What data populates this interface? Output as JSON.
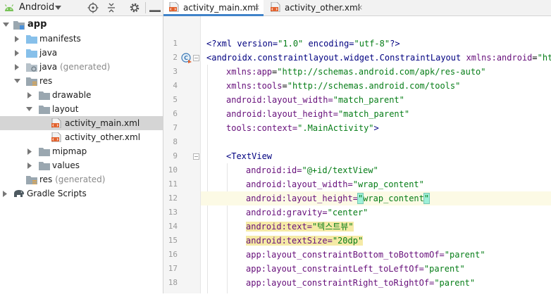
{
  "project_panel": {
    "view_title": "Android",
    "tree": [
      {
        "label": "app",
        "suffix": ""
      },
      {
        "label": "manifests",
        "suffix": ""
      },
      {
        "label": "java",
        "suffix": ""
      },
      {
        "label": "java",
        "suffix": " (generated)"
      },
      {
        "label": "res",
        "suffix": ""
      },
      {
        "label": "drawable",
        "suffix": ""
      },
      {
        "label": "layout",
        "suffix": ""
      },
      {
        "label": "activity_main.xml",
        "suffix": ""
      },
      {
        "label": "activity_other.xml",
        "suffix": ""
      },
      {
        "label": "mipmap",
        "suffix": ""
      },
      {
        "label": "values",
        "suffix": ""
      },
      {
        "label": "res",
        "suffix": " (generated)"
      },
      {
        "label": "Gradle Scripts",
        "suffix": ""
      }
    ]
  },
  "editor": {
    "tabs": [
      {
        "label": "activity_main.xml",
        "close": "×"
      },
      {
        "label": "activity_other.xml",
        "close": "×"
      }
    ],
    "line_numbers": [
      "1",
      "2",
      "3",
      "4",
      "5",
      "6",
      "7",
      "8",
      "9",
      "10",
      "11",
      "12",
      "13",
      "14",
      "15",
      "16",
      "17",
      "18"
    ],
    "code": {
      "l1": {
        "a": "<?xml version=",
        "b": "\"1.0\"",
        "c": " encoding=",
        "d": "\"utf-8\"",
        "e": "?>"
      },
      "l2": {
        "a": "<androidx.constraintlayout.widget.ConstraintLayout ",
        "b": "xmlns:",
        "c": "android",
        "d": "=",
        "e": "\"http"
      },
      "l3": {
        "a": "xmlns:",
        "b": "app",
        "c": "=",
        "d": "\"http://schemas.android.com/apk/res-auto\""
      },
      "l4": {
        "a": "xmlns:",
        "b": "tools",
        "c": "=",
        "d": "\"http://schemas.android.com/tools\""
      },
      "l5": {
        "a": "android",
        "b": ":layout_width=",
        "c": "\"match_parent\""
      },
      "l6": {
        "a": "android",
        "b": ":layout_height=",
        "c": "\"match_parent\""
      },
      "l7": {
        "a": "tools",
        "b": ":context=",
        "c": "\".MainActivity\"",
        "d": ">"
      },
      "l9": {
        "a": "<TextView"
      },
      "l10": {
        "a": "android",
        "b": ":id=",
        "c": "\"@+id/textView\""
      },
      "l11": {
        "a": "android",
        "b": ":layout_width=",
        "c": "\"wrap_content\""
      },
      "l12": {
        "a": "android",
        "b": ":layout_height=",
        "c": "\"",
        "d": "wrap_content",
        "e": "\""
      },
      "l13": {
        "a": "android",
        "b": ":gravity=",
        "c": "\"center\""
      },
      "l14": {
        "a": "android",
        "b": ":text=",
        "c": "\"텍스트뷰\""
      },
      "l15": {
        "a": "android",
        "b": ":textSize=",
        "c": "\"20dp\""
      },
      "l16": {
        "a": "app",
        "b": ":layout_constraintBottom_toBottomOf=",
        "c": "\"parent\""
      },
      "l17": {
        "a": "app",
        "b": ":layout_constraintLeft_toLeftOf=",
        "c": "\"parent\""
      },
      "l18": {
        "a": "app",
        "b": ":layout_constraintRight_toRightOf=",
        "c": "\"parent\""
      }
    }
  },
  "colors": {
    "tag": "#000080",
    "attribute": "#660e7a",
    "string": "#067d17",
    "selection": "#d5d5d5",
    "active_tab_underline": "#4083c9"
  },
  "icons": {
    "view": "android-icon",
    "folder": "folder-icon",
    "xml_file": "xml-file-icon",
    "gradle": "gradle-elephant-icon"
  }
}
